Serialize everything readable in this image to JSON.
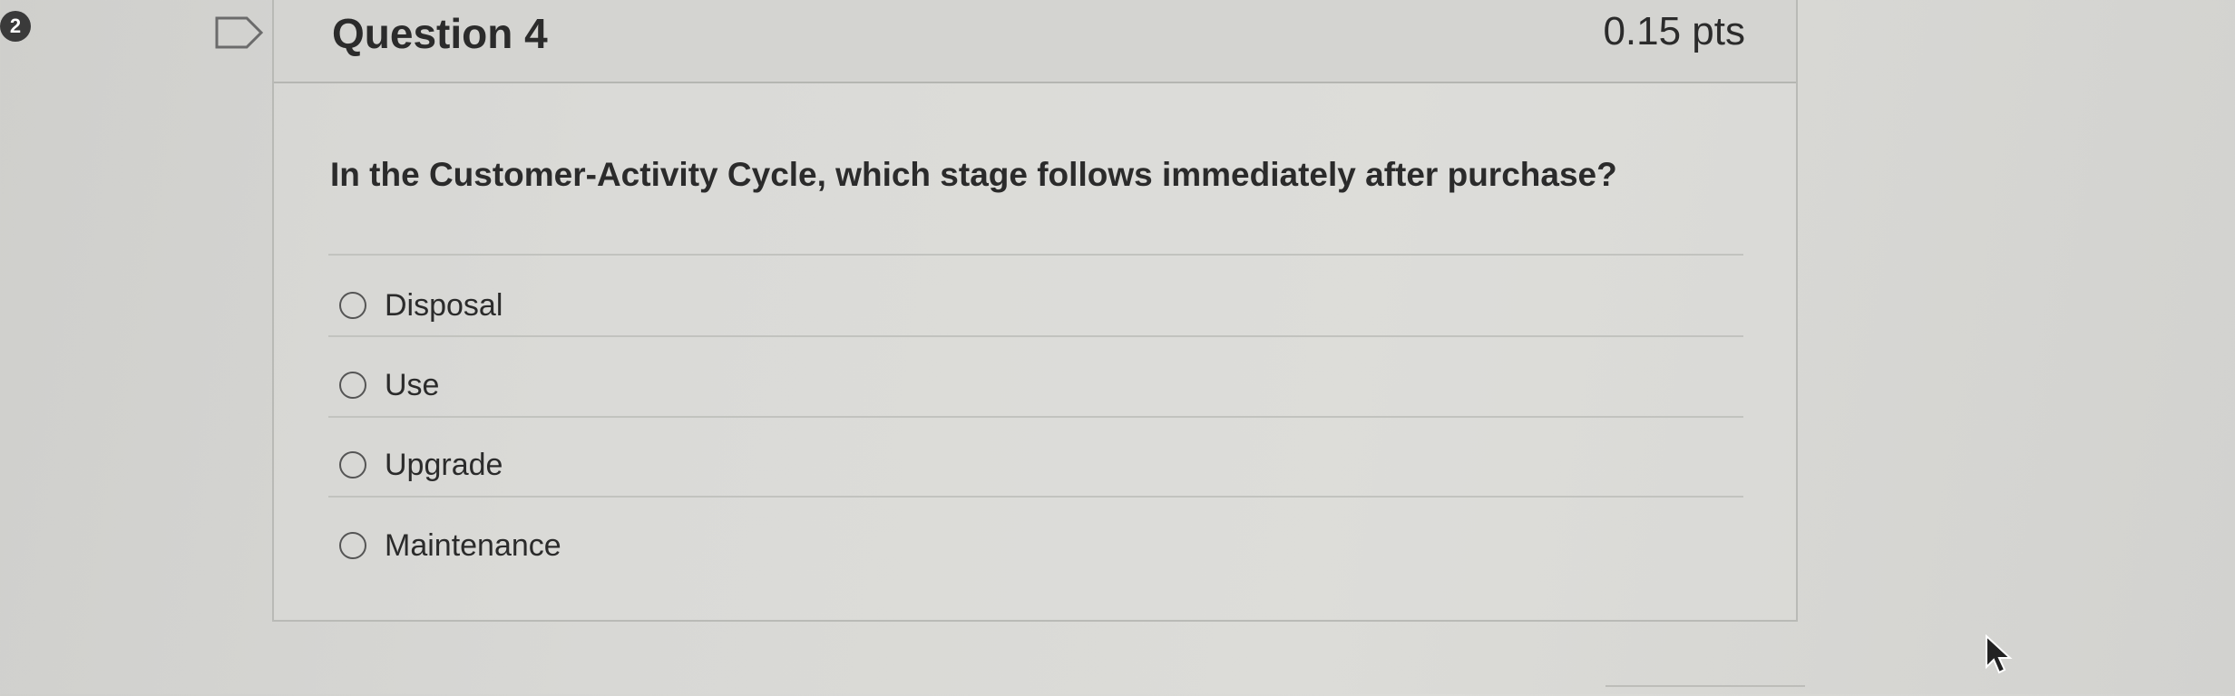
{
  "page_badge": "2",
  "question": {
    "title": "Question 4",
    "points": "0.15 pts",
    "text": "In the Customer-Activity Cycle, which stage follows immediately after purchase?",
    "answers": [
      {
        "label": "Disposal"
      },
      {
        "label": "Use"
      },
      {
        "label": "Upgrade"
      },
      {
        "label": "Maintenance"
      }
    ]
  },
  "icons": {
    "flag": "flag-outline-icon",
    "cursor": "mouse-pointer-icon"
  }
}
